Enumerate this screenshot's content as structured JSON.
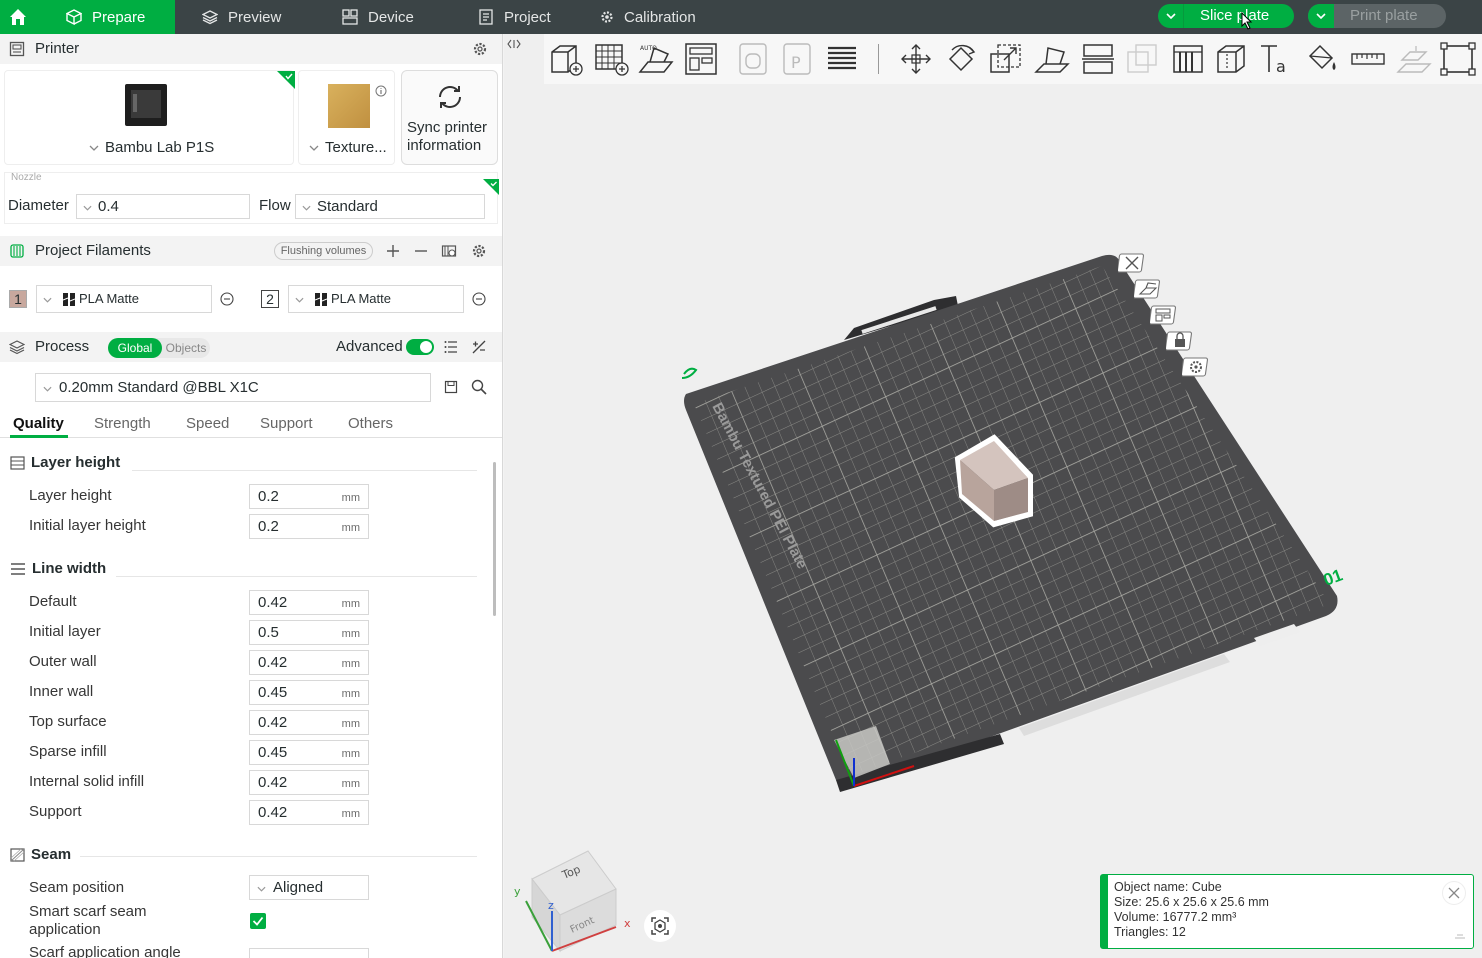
{
  "topbar": {
    "tabs": [
      {
        "label": "Prepare",
        "active": true
      },
      {
        "label": "Preview"
      },
      {
        "label": "Device"
      },
      {
        "label": "Project"
      },
      {
        "label": "Calibration"
      }
    ],
    "slice_label": "Slice plate",
    "print_label": "Print plate"
  },
  "printer": {
    "section_title": "Printer",
    "printer_name": "Bambu Lab P1S",
    "plate_name": "Texture...",
    "sync_label_1": "Sync printer",
    "sync_label_2": "information",
    "nozzle_label": "Nozzle",
    "diameter_label": "Diameter",
    "diameter_value": "0.4",
    "flow_label": "Flow",
    "flow_value": "Standard"
  },
  "filaments": {
    "title": "Project Filaments",
    "flushing_label": "Flushing volumes",
    "items": [
      {
        "index": "1",
        "name": "PLA Matte",
        "color": "#c8a89e"
      },
      {
        "index": "2",
        "name": "PLA Matte",
        "color": "#ffffff"
      }
    ]
  },
  "process": {
    "title": "Process",
    "global_label": "Global",
    "objects_label": "Objects",
    "advanced_label": "Advanced",
    "advanced_on": true,
    "preset": "0.20mm Standard @BBL X1C",
    "tabs": [
      "Quality",
      "Strength",
      "Speed",
      "Support",
      "Others"
    ],
    "active_tab": "Quality"
  },
  "quality": {
    "layer_height_group": "Layer height",
    "layer_height": {
      "label": "Layer height",
      "value": "0.2",
      "unit": "mm"
    },
    "initial_layer_height": {
      "label": "Initial layer height",
      "value": "0.2",
      "unit": "mm"
    },
    "line_width_group": "Line width",
    "line_widths": [
      {
        "label": "Default",
        "value": "0.42",
        "unit": "mm"
      },
      {
        "label": "Initial layer",
        "value": "0.5",
        "unit": "mm"
      },
      {
        "label": "Outer wall",
        "value": "0.42",
        "unit": "mm"
      },
      {
        "label": "Inner wall",
        "value": "0.45",
        "unit": "mm"
      },
      {
        "label": "Top surface",
        "value": "0.42",
        "unit": "mm"
      },
      {
        "label": "Sparse infill",
        "value": "0.45",
        "unit": "mm"
      },
      {
        "label": "Internal solid infill",
        "value": "0.42",
        "unit": "mm"
      },
      {
        "label": "Support",
        "value": "0.42",
        "unit": "mm"
      }
    ],
    "seam_group": "Seam",
    "seam_position_label": "Seam position",
    "seam_position_value": "Aligned",
    "smart_scarf_label_1": "Smart scarf seam",
    "smart_scarf_label_2": "application",
    "smart_scarf_checked": true,
    "scarf_angle_label": "Scarf application angle"
  },
  "viewport": {
    "plate_text": "Bambu Textured PEI Plate",
    "plate_number": "01",
    "cube_top": "Top",
    "cube_front": "Front",
    "axis_x": "x",
    "axis_y": "y",
    "axis_z": "z"
  },
  "object_info": {
    "name_line": "Object name: Cube",
    "size_line": "Size: 25.6 x 25.6 x 25.6 mm",
    "volume_line": "Volume: 16777.2 mm³",
    "triangles_line": "Triangles: 12"
  },
  "colors": {
    "accent": "#00ae42",
    "topbar": "#3b4446",
    "plate": "#4b4b4d"
  }
}
